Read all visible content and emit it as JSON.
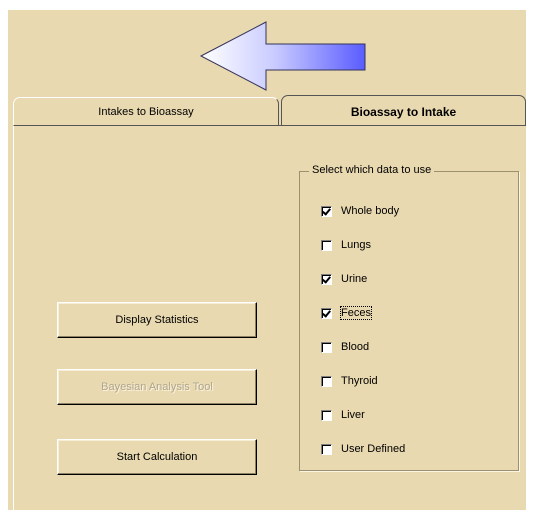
{
  "tabs": {
    "intakes_to_bioassay": "Intakes to Bioassay",
    "bioassay_to_intake": "Bioassay to Intake"
  },
  "buttons": {
    "display_statistics": "Display Statistics",
    "bayesian_analysis_tool": "Bayesian Analysis Tool",
    "start_calculation": "Start Calculation"
  },
  "data_group": {
    "title": "Select which data to use",
    "options": [
      {
        "label": "Whole body",
        "checked": true
      },
      {
        "label": "Lungs",
        "checked": false
      },
      {
        "label": "Urine",
        "checked": true
      },
      {
        "label": "Feces",
        "checked": true
      },
      {
        "label": "Blood",
        "checked": false
      },
      {
        "label": "Thyroid",
        "checked": false
      },
      {
        "label": "Liver",
        "checked": false
      },
      {
        "label": "User Defined",
        "checked": false
      }
    ]
  },
  "colors": {
    "panel_background": "#e9d9b0",
    "arrow_start": "#ffffff",
    "arrow_end": "#5a5cff"
  },
  "icons": {
    "back_arrow": "left-arrow-icon"
  }
}
